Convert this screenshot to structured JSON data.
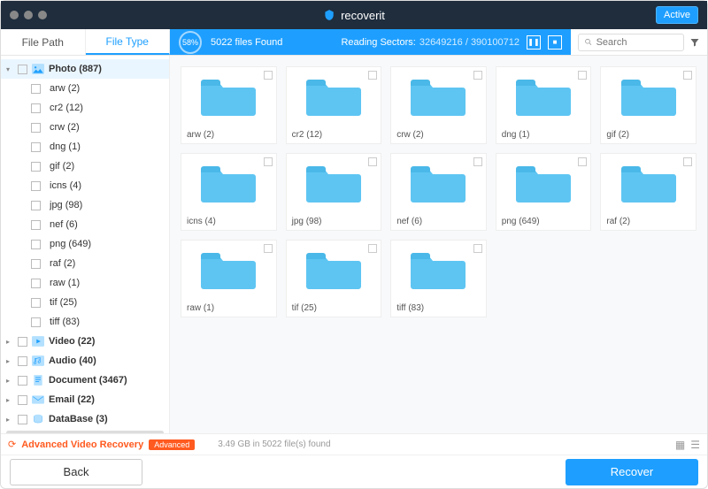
{
  "header": {
    "brand": "recoverit",
    "active_label": "Active"
  },
  "tabs": {
    "path": "File Path",
    "type": "File Type"
  },
  "scan": {
    "percent": "58%",
    "files_found": "5022 files Found",
    "reading_label": "Reading Sectors:",
    "sectors": "32649216 / 390100712"
  },
  "search": {
    "placeholder": "Search"
  },
  "sidebar": {
    "photo": "Photo (887)",
    "children": [
      "arw (2)",
      "cr2 (12)",
      "crw (2)",
      "dng (1)",
      "gif (2)",
      "icns (4)",
      "jpg (98)",
      "nef (6)",
      "png (649)",
      "raf (2)",
      "raw (1)",
      "tif (25)",
      "tiff (83)"
    ],
    "video": "Video (22)",
    "audio": "Audio (40)",
    "document": "Document (3467)",
    "email": "Email (22)",
    "database": "DataBase (3)"
  },
  "grid": [
    "arw (2)",
    "cr2 (12)",
    "crw (2)",
    "dng (1)",
    "gif (2)",
    "icns (4)",
    "jpg (98)",
    "nef (6)",
    "png (649)",
    "raf (2)",
    "raw (1)",
    "tif (25)",
    "tiff (83)"
  ],
  "footer": {
    "adv_label": "Advanced Video Recovery",
    "adv_badge": "Advanced",
    "status": "3.49 GB in 5022 file(s) found",
    "back": "Back",
    "recover": "Recover"
  }
}
